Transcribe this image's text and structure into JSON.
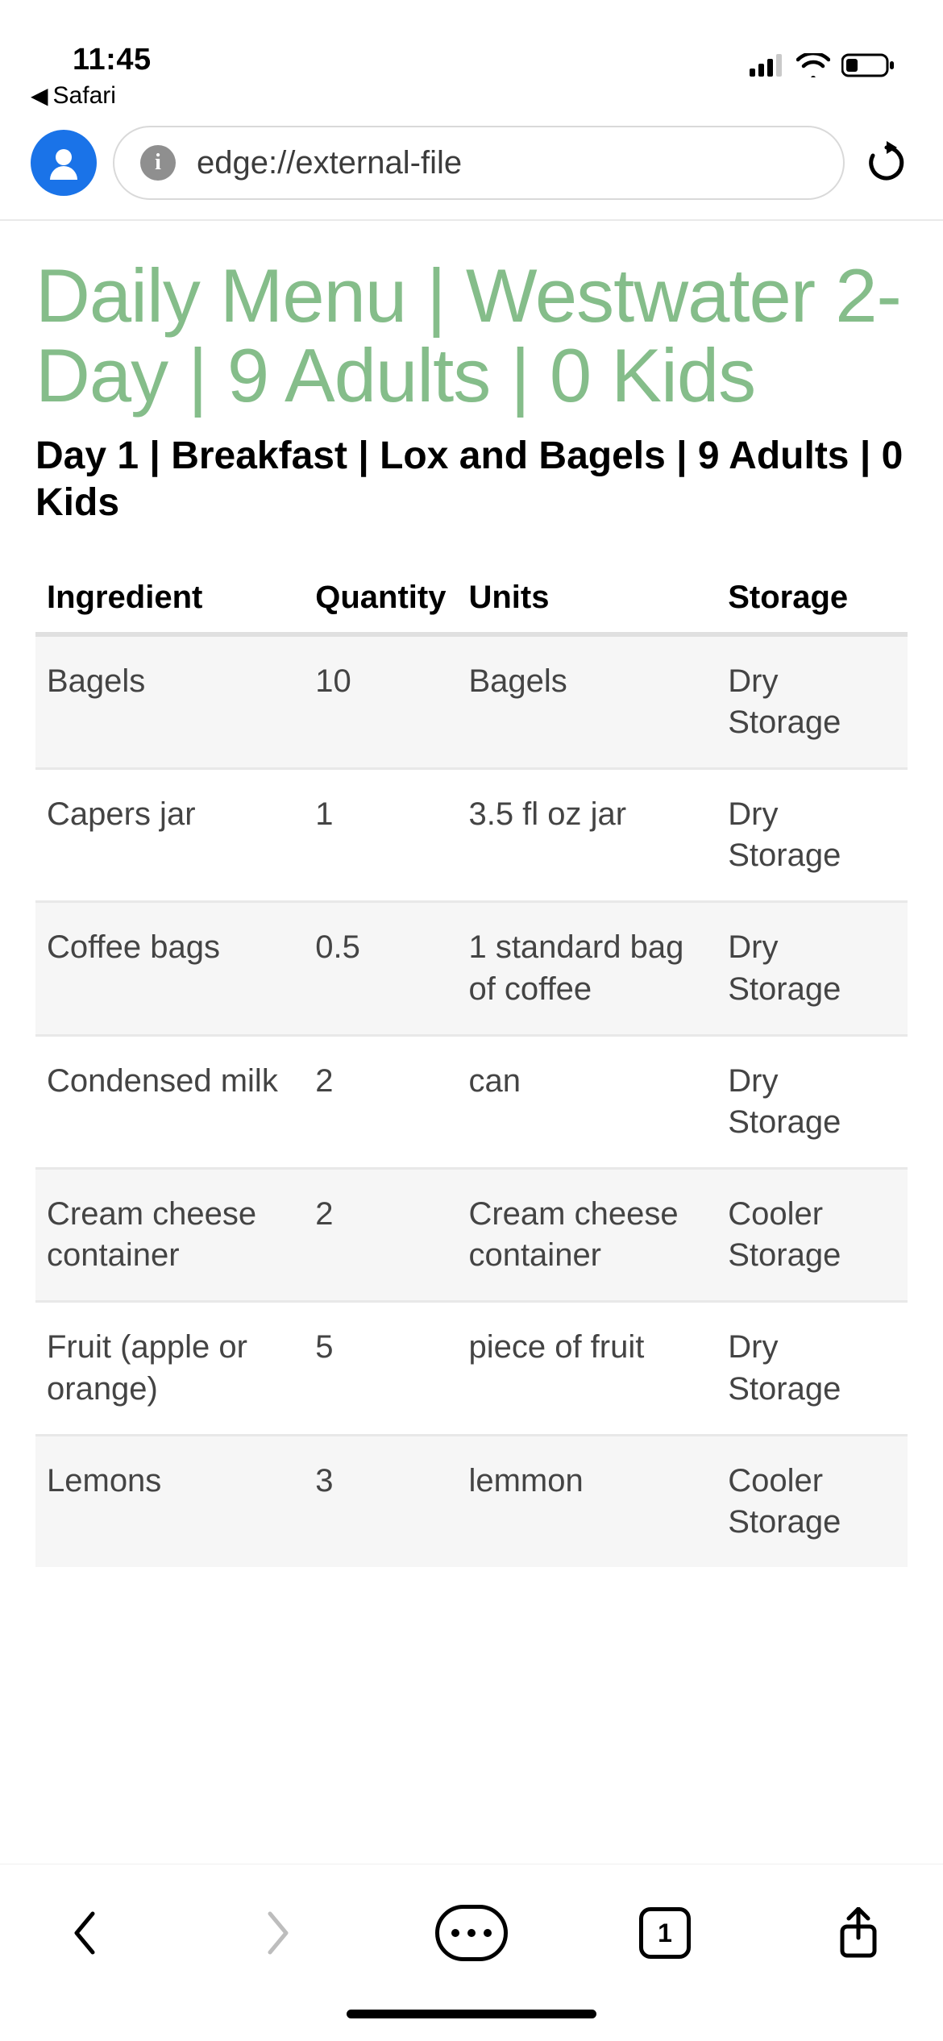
{
  "status": {
    "time": "11:45",
    "back_app_label": "Safari"
  },
  "browser": {
    "url": "edge://external-file",
    "tab_count": "1"
  },
  "page": {
    "title": "Daily Menu | Westwater 2-Day | 9 Adults | 0 Kids",
    "meal_heading": "Day 1 | Breakfast | Lox and Bagels | 9 Adults | 0 Kids",
    "columns": {
      "ingredient": "Ingredient",
      "quantity": "Quantity",
      "units": "Units",
      "storage": "Storage"
    },
    "rows": [
      {
        "ingredient": "Bagels",
        "quantity": "10",
        "units": "Bagels",
        "storage": "Dry Storage"
      },
      {
        "ingredient": "Capers jar",
        "quantity": "1",
        "units": "3.5 fl oz jar",
        "storage": "Dry Storage"
      },
      {
        "ingredient": "Coffee bags",
        "quantity": "0.5",
        "units": "1 standard bag of coffee",
        "storage": "Dry Storage"
      },
      {
        "ingredient": "Condensed milk",
        "quantity": "2",
        "units": "can",
        "storage": "Dry Storage"
      },
      {
        "ingredient": "Cream cheese container",
        "quantity": "2",
        "units": "Cream cheese container",
        "storage": "Cooler Storage"
      },
      {
        "ingredient": "Fruit (apple or orange)",
        "quantity": "5",
        "units": "piece of fruit",
        "storage": "Dry Storage"
      },
      {
        "ingredient": "Lemons",
        "quantity": "3",
        "units": "lemmon",
        "storage": "Cooler Storage"
      }
    ]
  }
}
